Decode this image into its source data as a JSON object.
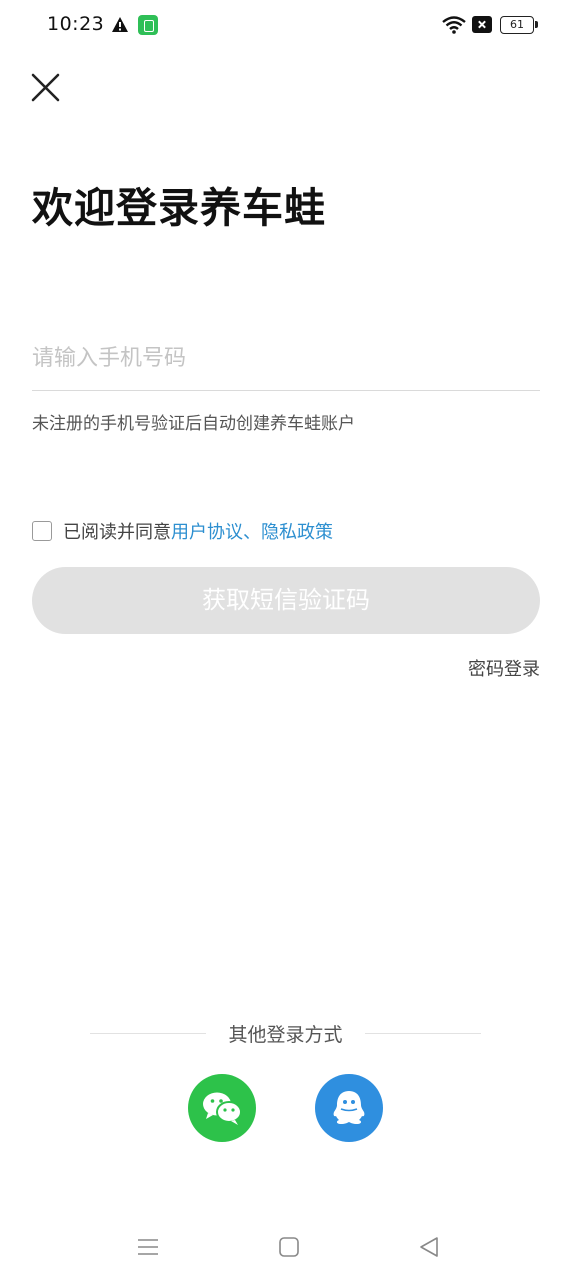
{
  "status_bar": {
    "time": "10:23",
    "battery": "61",
    "icons": [
      "warning-icon",
      "app-notification-icon",
      "wifi-icon",
      "sim-off-icon",
      "battery-icon"
    ]
  },
  "header": {
    "close_icon": "close-icon",
    "title": "欢迎登录养车蛙"
  },
  "login_form": {
    "phone_placeholder": "请输入手机号码",
    "phone_value": "",
    "hint": "未注册的手机号验证后自动创建养车蛙账户",
    "agreement": {
      "checked": false,
      "prefix": "已阅读并同意",
      "user_agreement": "用户协议",
      "separator": "、",
      "privacy_policy": "隐私政策"
    },
    "sms_button": "获取短信验证码",
    "password_login": "密码登录"
  },
  "other_login": {
    "label": "其他登录方式",
    "methods": [
      {
        "name": "wechat",
        "icon": "wechat-icon",
        "color": "#2dc24a"
      },
      {
        "name": "qq",
        "icon": "qq-icon",
        "color": "#2f8fdf"
      }
    ]
  },
  "colors": {
    "link": "#2d8fd0",
    "button_disabled": "#e1e1e1",
    "title": "#111111"
  },
  "nav_bar": {
    "buttons": [
      "menu-icon",
      "home-icon",
      "back-icon"
    ]
  }
}
